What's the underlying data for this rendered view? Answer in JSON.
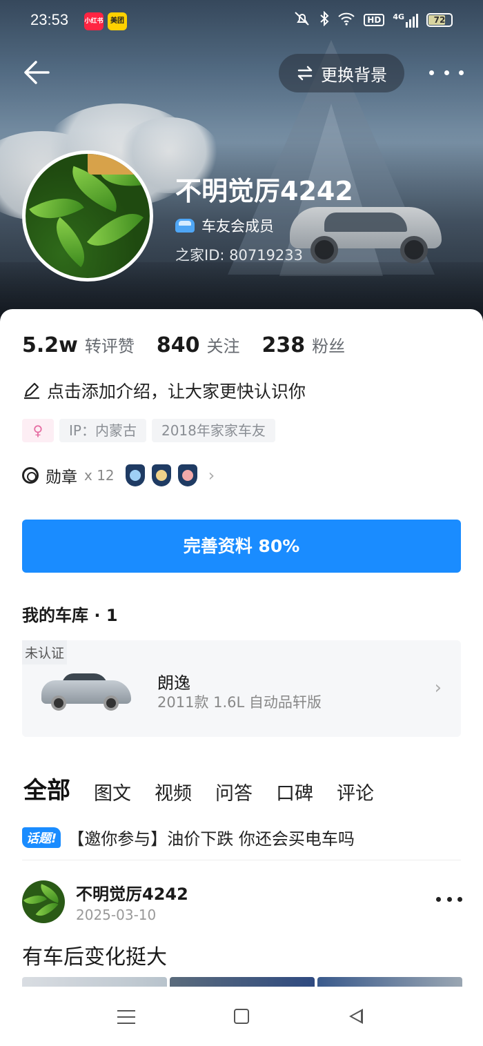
{
  "status_bar": {
    "time": "23:53",
    "apps": [
      "小红书",
      "美团"
    ],
    "network": "4G",
    "hd_label": "HD",
    "battery": "72"
  },
  "header": {
    "change_bg_label": "更换背景"
  },
  "profile": {
    "username": "不明觉厉4242",
    "member_label": "车友会成员",
    "home_id": "之家ID: 80719233"
  },
  "stats": [
    {
      "value": "5.2w",
      "label": "转评赞"
    },
    {
      "value": "840",
      "label": "关注"
    },
    {
      "value": "238",
      "label": "粉丝"
    }
  ],
  "intro": "点击添加介绍，让大家更快认识你",
  "tags": {
    "gender_symbol": "♀",
    "ip": "IP：内蒙古",
    "since": "2018年家家车友"
  },
  "medals": {
    "label": "勋章",
    "count": "x 12"
  },
  "complete_button": "完善资料 80%",
  "garage": {
    "title": "我的车库 · 1",
    "status": "未认证",
    "car_name": "朗逸",
    "car_spec": "2011款 1.6L 自动品轩版"
  },
  "tabs": [
    {
      "label": "全部",
      "active": true
    },
    {
      "label": "图文"
    },
    {
      "label": "视频"
    },
    {
      "label": "问答"
    },
    {
      "label": "口碑"
    },
    {
      "label": "评论"
    }
  ],
  "topic": {
    "tag": "话题!",
    "text": "【邀你参与】油价下跌 你还会买电车吗"
  },
  "post": {
    "username": "不明觉厉4242",
    "date": "2025-03-10",
    "title": "有车后变化挺大"
  },
  "colors": {
    "accent": "#1a8cff",
    "member_car_icon": "#4fa6f5",
    "gender_tag": "#e56aa0"
  }
}
